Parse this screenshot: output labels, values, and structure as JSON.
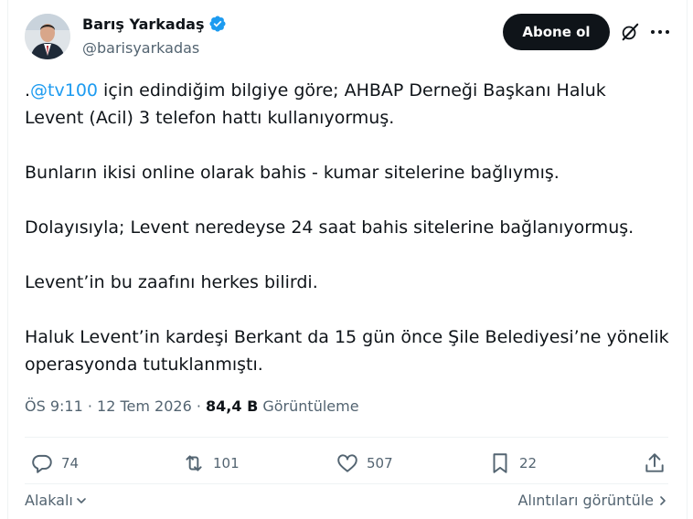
{
  "author": {
    "name": "Barış Yarkadaş",
    "handle": "@barisyarkadas"
  },
  "follow_label": "Abone ol",
  "tweet": {
    "prefix": ".",
    "mention": "@tv100",
    "line1_rest": " için edindiğim bilgiye göre; AHBAP Derneği Başkanı Haluk",
    "line2": "Levent (Acil) 3 telefon hattı kullanıyormuş.",
    "para2": "Bunların ikisi online olarak bahis - kumar sitelerine bağlıymış.",
    "para3": "Dolayısıyla; Levent neredeyse 24 saat bahis sitelerine bağlanıyormuş.",
    "para4": "Levent’in bu zaafını herkes bilirdi.",
    "para5_line1": "Haluk Levent’in kardeşi Berkant da 15 gün önce Şile Belediyesi’ne yönelik",
    "para5_line2": "operasyonda tutuklanmıştı."
  },
  "meta": {
    "time": "ÖS 9:11",
    "sep": " · ",
    "date": "12 Tem 2026",
    "sep2": " · ",
    "views": "84,4 B",
    "views_label": " Görüntüleme"
  },
  "actions": {
    "replies": "74",
    "reposts": "101",
    "likes": "507",
    "bookmarks": "22"
  },
  "footer": {
    "related": "Alakalı",
    "quotes": "Alıntıları görüntüle"
  },
  "colors": {
    "accent": "#1d9bf0",
    "text": "#0f1419",
    "muted": "#536471"
  }
}
